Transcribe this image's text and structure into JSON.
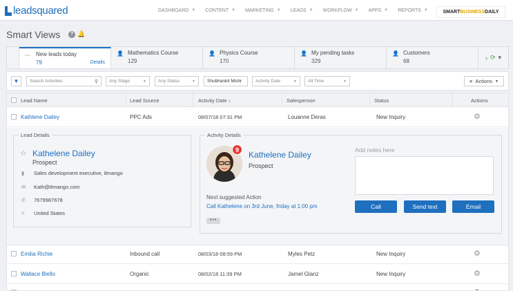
{
  "brand": {
    "logo_text": "leadsquared",
    "watermark_a": "SMART",
    "watermark_b": "BUSINESS",
    "watermark_c": "DAILY"
  },
  "nav": [
    "DASHBOARD",
    "CONTENT",
    "MARKETING",
    "LEADS",
    "WORKFLOW",
    "APPS",
    "REPORTS"
  ],
  "page": {
    "title": "Smart Views"
  },
  "tabs": [
    {
      "label": "New leads today",
      "count": "79",
      "details": "Details",
      "icon": "activity-icon"
    },
    {
      "label": "Mathematics Course",
      "count": "129",
      "icon": "user-icon"
    },
    {
      "label": "Physics Course",
      "count": "170",
      "icon": "user-icon"
    },
    {
      "label": "My pending tasks",
      "count": "329",
      "icon": "user-icon"
    },
    {
      "label": "Customers",
      "count": "68",
      "icon": "user-icon"
    }
  ],
  "filters": {
    "search_placeholder": "Search Activities",
    "stage": "Any Stage",
    "status": "Any Status",
    "owner": "Shubhankit Mishr",
    "date_field": "Activity Date",
    "date_range": "All Time",
    "actions": "Actions"
  },
  "table": {
    "headers": [
      "Lead Name",
      "Lead Source",
      "Activity Date",
      "Salesperson",
      "Status",
      "Actions"
    ],
    "rows": [
      {
        "name": "Kathlene Dailey",
        "source": "PPC Ads",
        "date": "08/07/18 07:31 PM",
        "sales": "Louanne Deras",
        "status": "New Inquiry"
      },
      {
        "name": "Emilia Richie",
        "source": "Inbound call",
        "date": "08/03/18 08:59 PM",
        "sales": "Myles Petz",
        "status": "New Inquiry"
      },
      {
        "name": "Wallace Biello",
        "source": "Organic",
        "date": "08/02/18 11:39 PM",
        "sales": "Jamel Glanz",
        "status": "New Inquiry"
      }
    ]
  },
  "lead_details": {
    "legend": "Lead Details",
    "name": "Kathelene Dailey",
    "type": "Prospect",
    "job": "Sales development executive, 8mango",
    "email": "Kath@8mango.com",
    "phone": "7679987678",
    "country": "United States"
  },
  "activity_details": {
    "legend": "Activity Details",
    "badge": "9",
    "name": "Kathelene Dailey",
    "type": "Prospect",
    "next_label": "Next suggested Action",
    "next_action": "Call Kathelene on 3rd June, friday at 1:00 pm",
    "more": "•••",
    "notes_placeholder": "Add notes here",
    "buttons": [
      "Call",
      "Send text",
      "Email"
    ]
  }
}
